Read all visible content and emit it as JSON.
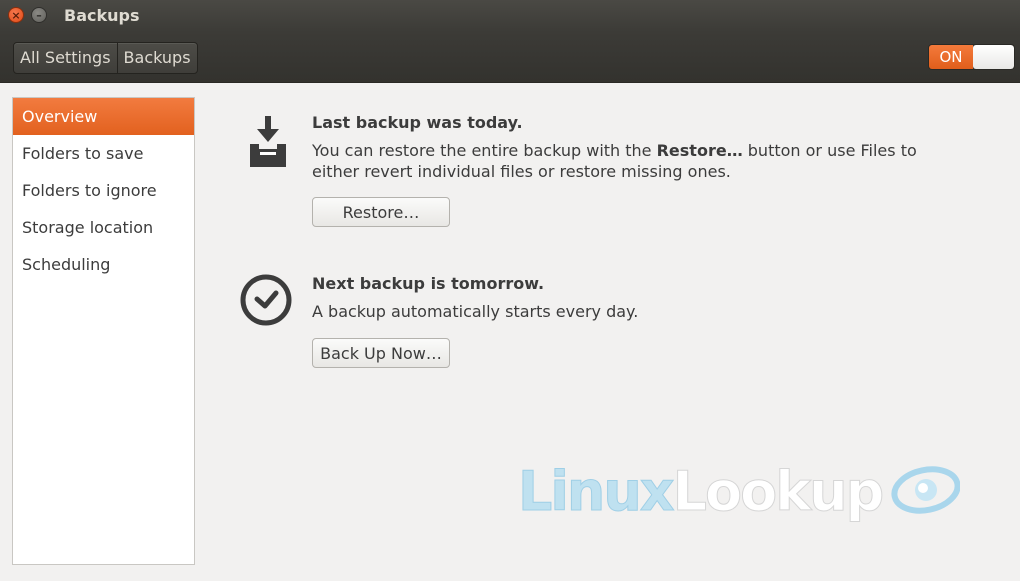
{
  "window": {
    "title": "Backups",
    "close_glyph": "×",
    "minimize_glyph": "–"
  },
  "toolbar": {
    "breadcrumbs": [
      "All Settings",
      "Backups"
    ],
    "toggle_label": "ON",
    "toggle_on": true
  },
  "sidebar": {
    "items": [
      {
        "label": "Overview",
        "active": true
      },
      {
        "label": "Folders to save",
        "active": false
      },
      {
        "label": "Folders to ignore",
        "active": false
      },
      {
        "label": "Storage location",
        "active": false
      },
      {
        "label": "Scheduling",
        "active": false
      }
    ]
  },
  "overview": {
    "last_backup": {
      "icon": "download-tray-icon",
      "heading": "Last backup was today.",
      "desc_before": "You can restore the entire backup with the ",
      "desc_bold": "Restore…",
      "desc_after": " button or use Files to either revert individual files or restore missing ones.",
      "button_label": "Restore…"
    },
    "next_backup": {
      "icon": "clock-icon",
      "heading": "Next backup is tomorrow.",
      "desc": "A backup automatically starts every day.",
      "button_label": "Back Up Now…"
    }
  },
  "watermark": {
    "part1": "Linux",
    "part2": "Lookup",
    "icon": "eye-swirl-logo-icon"
  },
  "colors": {
    "accent": "#e9672a",
    "titlebar": "#3c3b37",
    "background": "#f2f1f0",
    "text": "#3c3c3c"
  }
}
